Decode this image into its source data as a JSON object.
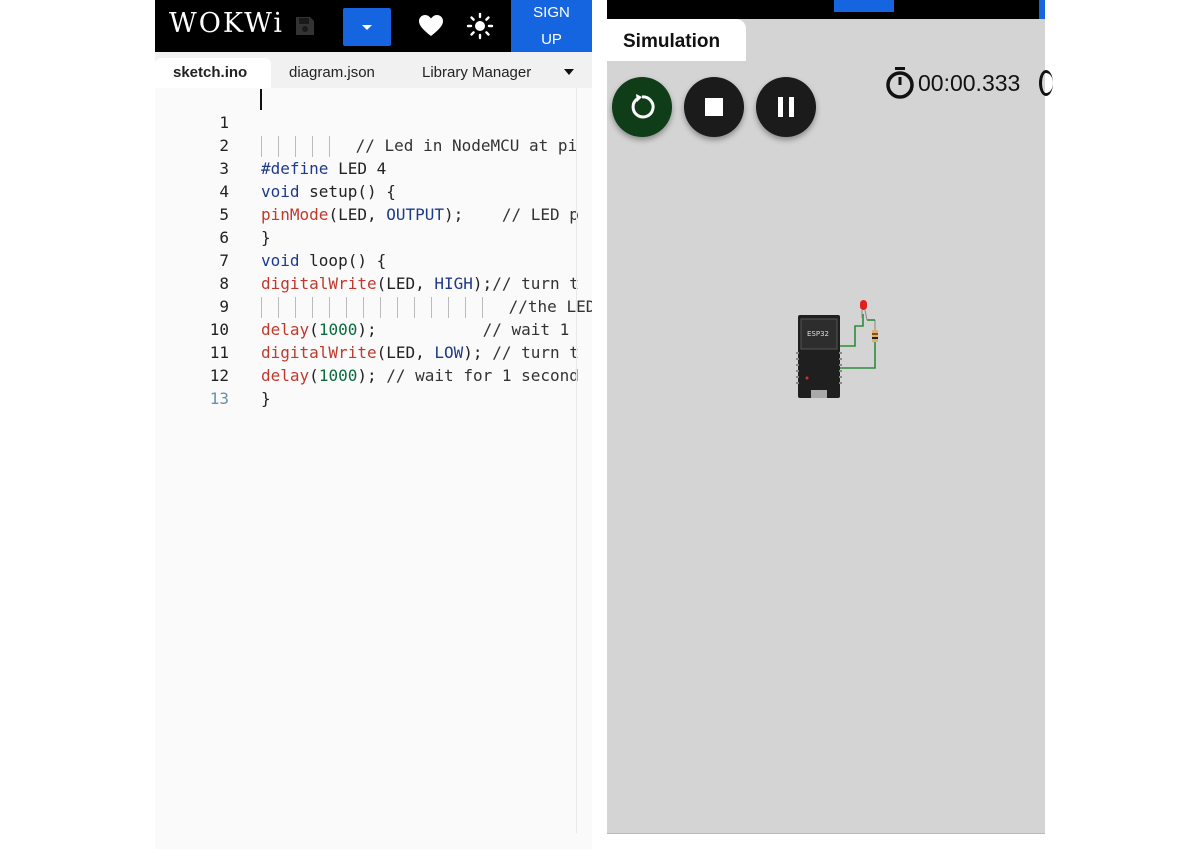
{
  "header": {
    "logo": "WOKWi",
    "signup_line1": "SIGN",
    "signup_line2": "UP",
    "accent_color": "#1565e0"
  },
  "tabs": [
    {
      "label": "sketch.ino",
      "active": true
    },
    {
      "label": "diagram.json",
      "active": false
    },
    {
      "label": "Library Manager",
      "active": false
    }
  ],
  "code": {
    "line_numbers": [
      "1",
      "2",
      "3",
      "4",
      "5",
      "6",
      "7",
      "8",
      "9",
      "10",
      "11",
      "12",
      "13"
    ],
    "l1_comment": "// Led in NodeMCU at pi",
    "l2_kw": "#define",
    "l2_rest": " LED 4",
    "l3_kw": "void",
    "l3_rest": " setup() {",
    "l4_fn": "pinMode",
    "l4_a": "(LED, ",
    "l4_const": "OUTPUT",
    "l4_b": ");    ",
    "l4_comment": "// LED p",
    "l5": "}",
    "l6_kw": "void",
    "l6_rest": " loop() {",
    "l7_fn": "digitalWrite",
    "l7_a": "(LED, ",
    "l7_const": "HIGH",
    "l7_b": ");",
    "l7_comment": "// turn t",
    "l8_comment": "//the LED",
    "l9_fn": "delay",
    "l9_a": "(",
    "l9_num": "1000",
    "l9_b": ");           ",
    "l9_comment": "// wait 1",
    "l10_fn": "digitalWrite",
    "l10_a": "(LED, ",
    "l10_const": "LOW",
    "l10_b": "); ",
    "l10_comment": "// turn t",
    "l11_fn": "delay",
    "l11_a": "(",
    "l11_num": "1000",
    "l11_b": "); ",
    "l11_comment": "// wait for 1 second",
    "l12": "}"
  },
  "simulation": {
    "tab_label": "Simulation",
    "timer": "00:00.333",
    "board_label": "ESP32",
    "restart_color": "#0e3d18"
  }
}
